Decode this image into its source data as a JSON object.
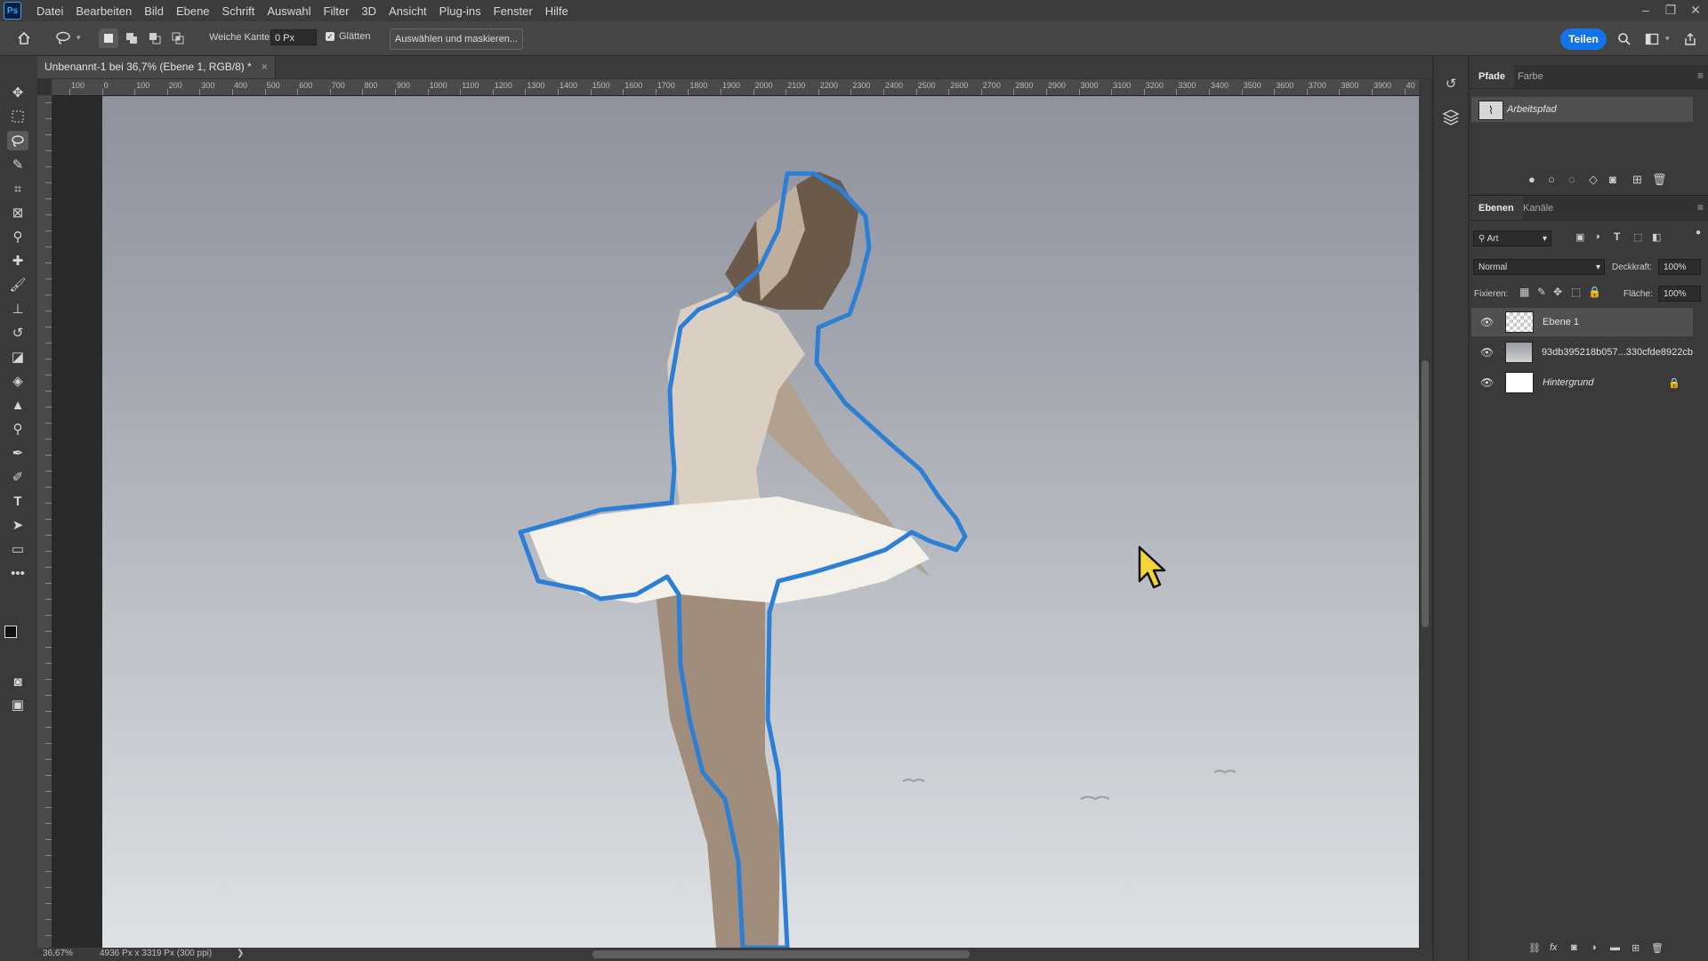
{
  "app": {
    "logo": "Ps"
  },
  "menu": [
    "Datei",
    "Bearbeiten",
    "Bild",
    "Ebene",
    "Schrift",
    "Auswahl",
    "Filter",
    "3D",
    "Ansicht",
    "Plug-ins",
    "Fenster",
    "Hilfe"
  ],
  "window_controls": {
    "minimize": "–",
    "restore": "❐",
    "close": "✕"
  },
  "options": {
    "feather_label": "Weiche Kante:",
    "feather_value": "0 Px",
    "smooth_label": "Glätten",
    "smooth_checked": true,
    "select_mask_label": "Auswählen und maskieren...",
    "share_label": "Teilen"
  },
  "document": {
    "tab_title": "Unbenannt-1 bei 36,7% (Ebene 1, RGB/8) *",
    "close": "×"
  },
  "ruler_labels": [
    "100",
    "0",
    "100",
    "200",
    "300",
    "400",
    "500",
    "600",
    "700",
    "800",
    "900",
    "1000",
    "1100",
    "1200",
    "1300",
    "1400",
    "1500",
    "1600",
    "1700",
    "1800",
    "1900",
    "2000",
    "2100",
    "2200",
    "2300",
    "2400",
    "2500",
    "2600",
    "2700",
    "2800",
    "2900",
    "3000",
    "3100",
    "3200",
    "3300",
    "3400",
    "3500",
    "3600",
    "3700",
    "3800",
    "3900",
    "40"
  ],
  "status": {
    "zoom": "36,67%",
    "doc_info": "4936 Px x 3319 Px (300 ppi)",
    "arrow": "❯"
  },
  "paths_panel": {
    "tabs": [
      "Pfade",
      "Farbe"
    ],
    "active_tab": "Pfade",
    "items": [
      {
        "name": "Arbeitspfad"
      }
    ]
  },
  "layers_panel": {
    "tabs": [
      "Ebenen",
      "Kanäle"
    ],
    "active_tab": "Ebenen",
    "filter_label": "Art",
    "blend_mode": "Normal",
    "opacity_label": "Deckkraft:",
    "opacity_value": "100%",
    "lock_label": "Fixieren:",
    "fill_label": "Fläche:",
    "fill_value": "100%",
    "layers": [
      {
        "name": "Ebene 1",
        "selected": true,
        "italic": false,
        "locked": false
      },
      {
        "name": "93db395218b057...330cfde8922cb",
        "selected": false,
        "italic": false,
        "locked": false
      },
      {
        "name": "Hintergrund",
        "selected": false,
        "italic": true,
        "locked": true
      }
    ]
  },
  "colors": {
    "accent": "#1473e6",
    "selection_outline": "#2d7fd6",
    "panel_bg": "#3a3a3a"
  }
}
